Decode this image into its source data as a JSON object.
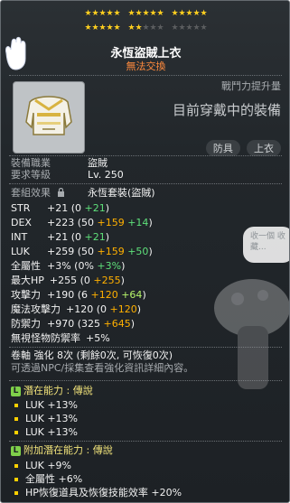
{
  "item": {
    "name": "永恆盜賊上衣",
    "tradeable": "無法交換",
    "star_rows": [
      {
        "groups": [
          5,
          5,
          5
        ],
        "filled": [
          5,
          5,
          5
        ]
      },
      {
        "groups": [
          5,
          5,
          5
        ],
        "filled": [
          5,
          2,
          0
        ]
      }
    ],
    "combat_power_label": "戰鬥力提升量",
    "current_equip_note": "目前穿戴中的裝備",
    "tags": [
      "防具",
      "上衣"
    ],
    "req_job_label": "裝備職業",
    "req_job": "盜賊",
    "req_level_label": "要求等級",
    "req_level": "Lv. 250",
    "set_label": "套組效果",
    "set_name": "永恆套裝(盜賊)"
  },
  "stats": [
    {
      "name": "STR",
      "parts": [
        {
          "t": "+21 (0 ",
          "c": "white"
        },
        {
          "t": "+21",
          "c": "green"
        },
        {
          "t": ")",
          "c": "white"
        }
      ]
    },
    {
      "name": "DEX",
      "parts": [
        {
          "t": "+223 (50 ",
          "c": "white"
        },
        {
          "t": "+159",
          "c": "orange"
        },
        {
          "t": " +14",
          "c": "green"
        },
        {
          "t": ")",
          "c": "white"
        }
      ]
    },
    {
      "name": "INT",
      "parts": [
        {
          "t": "+21 (0 ",
          "c": "white"
        },
        {
          "t": "+21",
          "c": "green"
        },
        {
          "t": ")",
          "c": "white"
        }
      ]
    },
    {
      "name": "LUK",
      "parts": [
        {
          "t": "+259 (50 ",
          "c": "white"
        },
        {
          "t": "+159",
          "c": "orange"
        },
        {
          "t": " +50",
          "c": "green"
        },
        {
          "t": ")",
          "c": "white"
        }
      ]
    },
    {
      "name": "全屬性",
      "parts": [
        {
          "t": "+3% (0% ",
          "c": "white"
        },
        {
          "t": "+3%",
          "c": "green"
        },
        {
          "t": ")",
          "c": "white"
        }
      ]
    },
    {
      "name": "最大HP",
      "parts": [
        {
          "t": "+255 (0 ",
          "c": "white"
        },
        {
          "t": "+255",
          "c": "orange"
        },
        {
          "t": ")",
          "c": "white"
        }
      ]
    },
    {
      "name": "攻擊力",
      "parts": [
        {
          "t": "+190 (6 ",
          "c": "white"
        },
        {
          "t": "+120",
          "c": "orange"
        },
        {
          "t": " +64",
          "c": "lgreen"
        },
        {
          "t": ")",
          "c": "white"
        }
      ]
    },
    {
      "name": "魔法攻擊力",
      "parts": [
        {
          "t": "+120 (0 ",
          "c": "white"
        },
        {
          "t": "+120",
          "c": "orange"
        },
        {
          "t": ")",
          "c": "white"
        }
      ]
    },
    {
      "name": "防禦力",
      "parts": [
        {
          "t": "+970 (325 ",
          "c": "white"
        },
        {
          "t": "+645",
          "c": "orange"
        },
        {
          "t": ")",
          "c": "white"
        }
      ]
    },
    {
      "name": "無視怪物防禦率",
      "parts": [
        {
          "t": "+5%",
          "c": "white"
        }
      ]
    }
  ],
  "upgrade_line": "卷軸 強化 8次 (剩餘0次, 可恢復0次)",
  "upgrade_note": "可透過NPC/採集查看強化資訊詳細內容。",
  "potential": {
    "title": "潛在能力 : 傳說",
    "icon": "L",
    "lines": [
      "LUK +13%",
      "LUK +13%",
      "LUK +13%"
    ]
  },
  "additional": {
    "title": "附加潛在能力 : 傳說",
    "icon": "L",
    "lines": [
      "LUK +9%",
      "全屬性 +6%",
      "HP恢復道具及恢復技能效率 +20%"
    ]
  },
  "bubble_text": "收一個 收藏..."
}
